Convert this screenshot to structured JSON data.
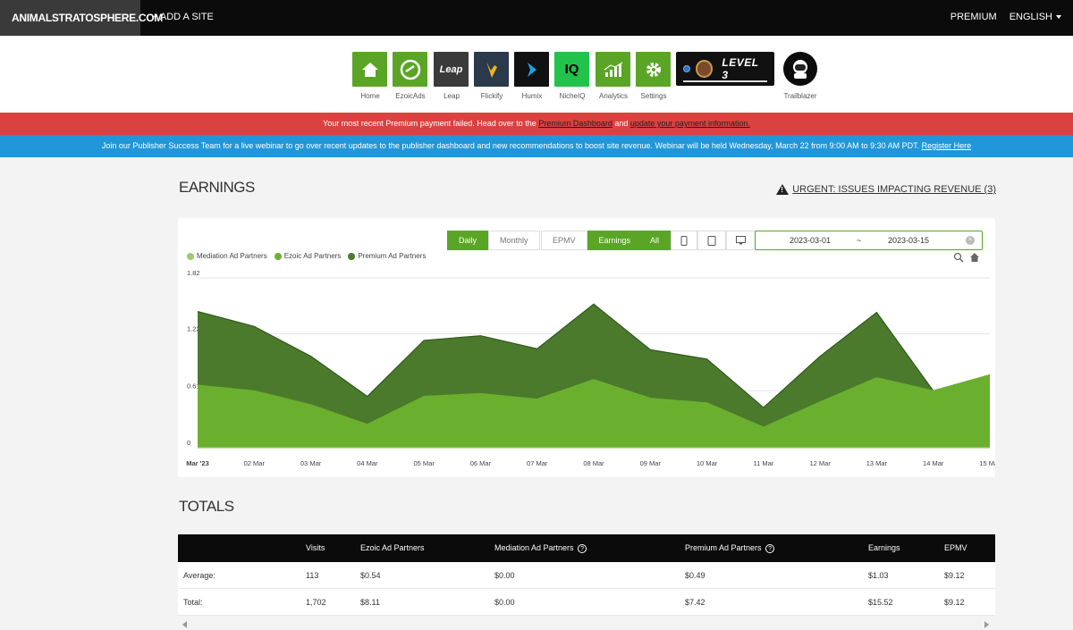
{
  "header": {
    "site_name": "ANIMALSTRATOSPHERE.COM",
    "add_site": "+ ADD A SITE",
    "premium": "PREMIUM",
    "language": "ENGLISH"
  },
  "apps": [
    {
      "label": "Home",
      "icon": "home-icon",
      "color": "#5aa525"
    },
    {
      "label": "EzoicAds",
      "icon": "ezoicads-icon",
      "color": "#5aa525"
    },
    {
      "label": "Leap",
      "icon": "leap-icon",
      "color": "#3a3a3a",
      "tile_text": "Leap"
    },
    {
      "label": "Flickify",
      "icon": "flickify-icon",
      "color": "#2b3a4a"
    },
    {
      "label": "Humix",
      "icon": "humix-icon",
      "color": "#111111"
    },
    {
      "label": "NicheIQ",
      "icon": "nicheiq-icon",
      "color": "#21c34a",
      "tile_text": "IQ"
    },
    {
      "label": "Analytics",
      "icon": "analytics-icon",
      "color": "#5aa525"
    },
    {
      "label": "Settings",
      "icon": "gear-icon",
      "color": "#5aa525"
    }
  ],
  "level_badge": {
    "text": "LEVEL 3"
  },
  "trailblazer": {
    "label": "Trailblazer"
  },
  "alerts": {
    "payment": {
      "text_before": "Your most recent Premium payment failed. Head over to the ",
      "link1": "Premium Dashboard",
      "text_mid": " and ",
      "link2": "update your payment information."
    },
    "webinar": {
      "text": "Join our Publisher Success Team for a live webinar to go over recent updates to the publisher dashboard and new recommendations to boost site revenue. Webinar will be held Wednesday, March 22 from 9:00 AM to 9:30 AM PDT. ",
      "link": "Register Here"
    }
  },
  "earnings": {
    "title": "EARNINGS",
    "urgent_link": "URGENT: ISSUES IMPACTING REVENUE (3)",
    "toggles": {
      "daily": "Daily",
      "monthly": "Monthly",
      "epmv": "EPMV",
      "earnings": "Earnings",
      "all": "All"
    },
    "date_from": "2023-03-01",
    "date_sep": "~",
    "date_to": "2023-03-15"
  },
  "chart_data": {
    "type": "area",
    "stacked": true,
    "x": [
      "Mar '23",
      "02 Mar",
      "03 Mar",
      "04 Mar",
      "05 Mar",
      "06 Mar",
      "07 Mar",
      "08 Mar",
      "09 Mar",
      "10 Mar",
      "11 Mar",
      "12 Mar",
      "13 Mar",
      "14 Mar",
      "15 Mar"
    ],
    "yticks": [
      "0",
      "0.61",
      "1.22",
      "1.82"
    ],
    "ylim": [
      0,
      1.82
    ],
    "series": [
      {
        "name": "Mediation Ad Partners",
        "color": "#9ccc6e",
        "values": [
          0,
          0,
          0,
          0,
          0,
          0,
          0,
          0,
          0,
          0,
          0,
          0,
          0,
          0,
          0
        ]
      },
      {
        "name": "Ezoic Ad Partners",
        "color": "#6ab02e",
        "values": [
          0.67,
          0.61,
          0.46,
          0.25,
          0.55,
          0.58,
          0.52,
          0.73,
          0.53,
          0.48,
          0.22,
          0.49,
          0.75,
          0.61,
          0.78
        ]
      },
      {
        "name": "Premium Ad Partners",
        "color": "#4b7a2c",
        "values": [
          0.79,
          0.69,
          0.52,
          0.3,
          0.6,
          0.62,
          0.54,
          0.81,
          0.52,
          0.47,
          0.21,
          0.49,
          0.7,
          0.0,
          0.0
        ]
      }
    ],
    "legend_position": "top-left",
    "grid": true
  },
  "totals": {
    "title": "TOTALS",
    "columns": [
      "",
      "Visits",
      "Ezoic Ad Partners",
      "Mediation Ad Partners",
      "Premium Ad Partners",
      "Earnings",
      "EPMV"
    ],
    "rows": [
      {
        "label": "Average:",
        "visits": "113",
        "ezoic": "$0.54",
        "mediation": "$0.00",
        "premium": "$0.49",
        "earnings": "$1.03",
        "epmv": "$9.12"
      },
      {
        "label": "Total:",
        "visits": "1,702",
        "ezoic": "$8.11",
        "mediation": "$0.00",
        "premium": "$7.42",
        "earnings": "$15.52",
        "epmv": "$9.12"
      }
    ]
  }
}
